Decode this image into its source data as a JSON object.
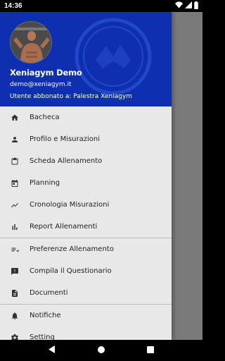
{
  "status_bar": {
    "time": "14:36"
  },
  "drawer": {
    "header": {
      "name": "Xeniagym Demo",
      "email": "demo@xeniagym.it",
      "subscription": "Utente abbonato a: Palestra Xeniagym"
    },
    "groups": [
      [
        {
          "label": "Bacheca",
          "icon": "home-icon"
        },
        {
          "label": "Profilo e Misurazioni",
          "icon": "person-icon"
        },
        {
          "label": "Scheda Allenamento",
          "icon": "clipboard-icon"
        },
        {
          "label": "Planning",
          "icon": "calendar-icon"
        },
        {
          "label": "Cronologia Misurazioni",
          "icon": "trending-icon"
        },
        {
          "label": "Report Allenamenti",
          "icon": "bar-chart-icon"
        }
      ],
      [
        {
          "label": "Preferenze Allenamento",
          "icon": "checklist-icon"
        },
        {
          "label": "Compila il Questionario",
          "icon": "feedback-icon"
        },
        {
          "label": "Documenti",
          "icon": "document-icon"
        }
      ],
      [
        {
          "label": "Notifiche",
          "icon": "bell-icon"
        },
        {
          "label": "Setting",
          "icon": "gear-icon"
        }
      ]
    ]
  },
  "colors": {
    "header": "#0d2fb0",
    "drawer_bg": "#e8e8e8",
    "scrim": "#7a7a7a"
  }
}
